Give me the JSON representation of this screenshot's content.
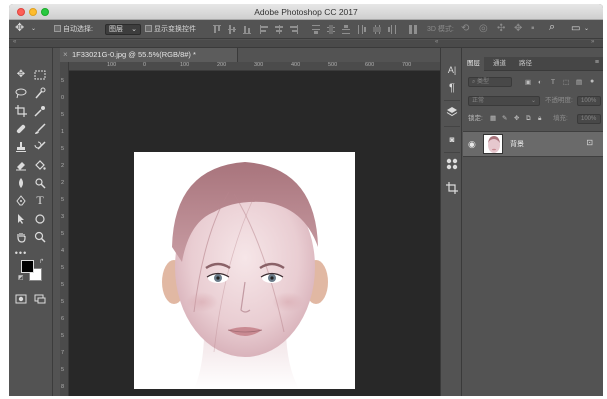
{
  "app": {
    "title": "Adobe Photoshop CC 2017"
  },
  "options_bar": {
    "auto_select_label": "自动选择:",
    "auto_select_value": "图层",
    "show_transform_label": "显示变换控件",
    "mode_3d_label": "3D 模式:"
  },
  "document": {
    "tab_label": "1F33021G-0.jpg @ 55.5%(RGB/8#) *",
    "close_glyph": "×",
    "ruler_h": [
      "100",
      "0",
      "100",
      "200",
      "300",
      "400",
      "500",
      "600",
      "700"
    ],
    "ruler_v": [
      "5",
      "0",
      "5",
      "1",
      "5",
      "2",
      "2",
      "5",
      "3",
      "5",
      "4",
      "5",
      "5",
      "5",
      "6",
      "5",
      "7",
      "5",
      "8"
    ]
  },
  "layers_panel": {
    "tabs": [
      "图层",
      "通道",
      "路径"
    ],
    "active_tab": "图层",
    "filter_label": "类型",
    "blend_mode": "正常",
    "opacity_label": "不透明度:",
    "opacity_value": "100%",
    "lock_label": "锁定:",
    "fill_label": "填充:",
    "fill_value": "100%",
    "layers": [
      {
        "name": "背景",
        "visible": true,
        "locked": true
      }
    ]
  },
  "colors": {
    "foreground": "#000000",
    "background": "#ffffff",
    "ui": "#535353",
    "pasteboard": "#282828"
  }
}
